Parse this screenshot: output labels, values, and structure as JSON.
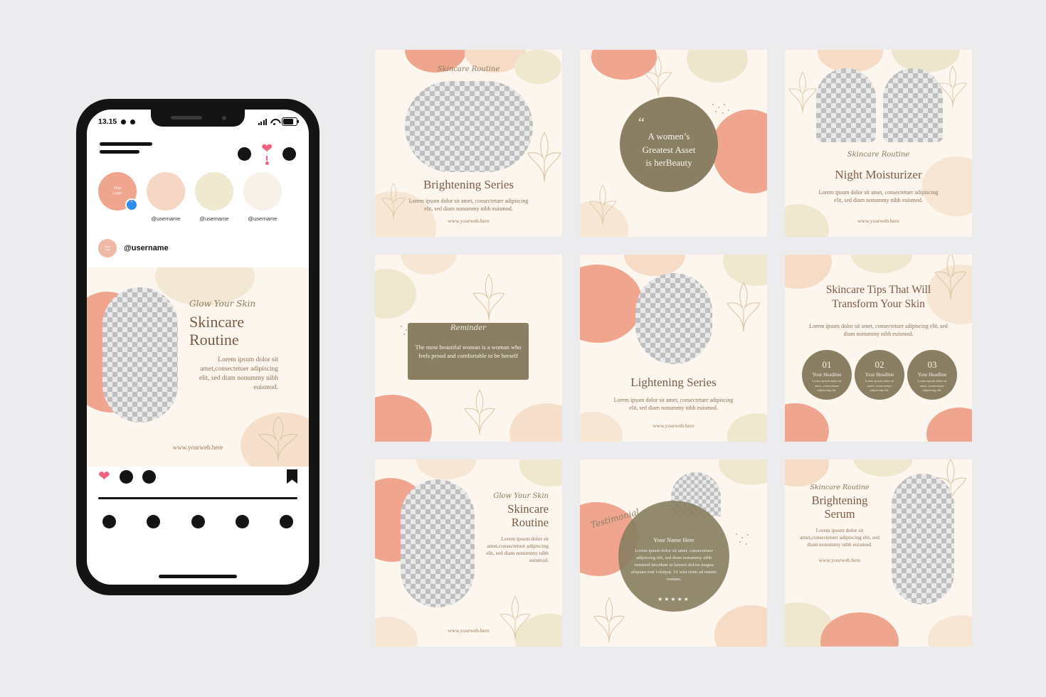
{
  "phone": {
    "status": {
      "time": "13.15",
      "signal_icon": "signal-bars-icon",
      "wifi_icon": "wifi-icon",
      "battery_icon": "battery-icon"
    },
    "header": {
      "logo_icon": "app-logo-lines",
      "icons": [
        "circle-icon",
        "heart-icon",
        "circle-icon"
      ]
    },
    "stories": [
      {
        "label": "Your\nLogo",
        "username": "",
        "color": "#f0a58f",
        "has_plus": true
      },
      {
        "label": "",
        "username": "@username",
        "color": "#f6d6c4",
        "has_plus": false
      },
      {
        "label": "",
        "username": "@username",
        "color": "#efe9d2",
        "has_plus": false
      },
      {
        "label": "",
        "username": "@username",
        "color": "#f7f1e8",
        "has_plus": false
      }
    ],
    "post_user": {
      "avatar_label": "Your\nLogo",
      "username": "@username"
    },
    "post": {
      "script_title": "Glow Your Skin",
      "title_line1": "Skincare",
      "title_line2": "Routine",
      "body": "Lorem ipsum dolor sit amet,consectetuer adipiscing elit, sed diam nonummy nibh euismod.",
      "web": "www.yourweb.here"
    },
    "actions": {
      "heart_icon": "heart-icon",
      "comment_icon": "comment-icon",
      "share_icon": "share-icon",
      "bookmark_icon": "bookmark-icon"
    },
    "tabbar_icons": [
      "home-icon",
      "search-icon",
      "reels-icon",
      "shop-icon",
      "profile-icon"
    ]
  },
  "cards": [
    {
      "id": "card-brightening-series",
      "kind": "photo-top",
      "script": "Skincare Routine",
      "title": "Brightening Series",
      "body": "Lorem ipsum dolor sit amet, consectetuer adipiscing elit, sed diam nonummy nibh euismod.",
      "web": "www.yourweb.here"
    },
    {
      "id": "card-quote-greatest-asset",
      "kind": "quote-circle",
      "quote_mark": "“",
      "quote_line1": "A women’s",
      "quote_line2": "Greatest Asset",
      "quote_line3": "is herBeauty"
    },
    {
      "id": "card-night-moisturizer",
      "kind": "photo-duo",
      "script": "Skincare Routine",
      "title": "Night Moisturizer",
      "body": "Lorem ipsum dolor sit amet, consectetuer adipiscing elit, sed diam nonummy nibh euismod.",
      "web": "www.yourweb.here"
    },
    {
      "id": "card-reminder",
      "kind": "reminder-box",
      "script": "Reminder",
      "body": "The most beautiful woman is a woman who feels proud and comfortable to be herself"
    },
    {
      "id": "card-lightening-series",
      "kind": "photo-center",
      "title": "Lightening Series",
      "body": "Lorem ipsum dolor sit amet, consectetuer adipiscing elit, sed diam nonummy nibh euismod.",
      "web": "www.yourweb.here"
    },
    {
      "id": "card-skincare-tips",
      "kind": "tips-numbers",
      "title_line1": "Skincare Tips That Will",
      "title_line2": "Transform Your Skin",
      "body": "Lorem ipsum dolor sit amet, consectetuer adipiscing elit, sed diam nonummy nibh euismod.",
      "steps": [
        {
          "number": "01",
          "headline": "Your Headline",
          "text": "Lorem ipsum dolor sit amet, consectetuer adipiscing elit."
        },
        {
          "number": "02",
          "headline": "Your Headline",
          "text": "Lorem ipsum dolor sit amet, consectetuer adipiscing elit."
        },
        {
          "number": "03",
          "headline": "Your Headline",
          "text": "Lorem ipsum dolor sit amet, consectetuer adipiscing elit."
        }
      ]
    },
    {
      "id": "card-glow-your-skin",
      "kind": "photo-left",
      "script": "Glow Your Skin",
      "title_line1": "Skincare",
      "title_line2": "Routine",
      "body": "Lorem ipsum dolor sit amet,consectetuer adipiscing elit, sed diam nonummy nibh euismod.",
      "web": "www.yourweb.here"
    },
    {
      "id": "card-testimonial",
      "kind": "testimonial",
      "script": "Testimonial",
      "name": "Your Name Here",
      "body": "Lorem ipsum dolor sit amet, consectetuer adipiscing elit, sed diam nonummy nibh euismod tincidunt ut laoreet dolore magna aliquam erat volutpat. Ut wisi enim ad minim veniam.",
      "stars": "★★★★★"
    },
    {
      "id": "card-brightening-serum",
      "kind": "photo-right",
      "script": "Skincare Routine",
      "title_line1": "Brightening",
      "title_line2": "Serum",
      "body": "Lorem ipsum dolor sit amet,consectetuer adipiscing elit, sed diam nonummy nibh euismod.",
      "web": "www.yourweb.here"
    }
  ],
  "colors": {
    "background": "#ececee",
    "card_bg": "#fdf6ef",
    "salmon": "#f0a58f",
    "peach": "#f7d9c4",
    "cream": "#ece7cf",
    "olive": "#8a7f62",
    "brown_text": "#7d5a46",
    "body_text": "#8a7458"
  }
}
